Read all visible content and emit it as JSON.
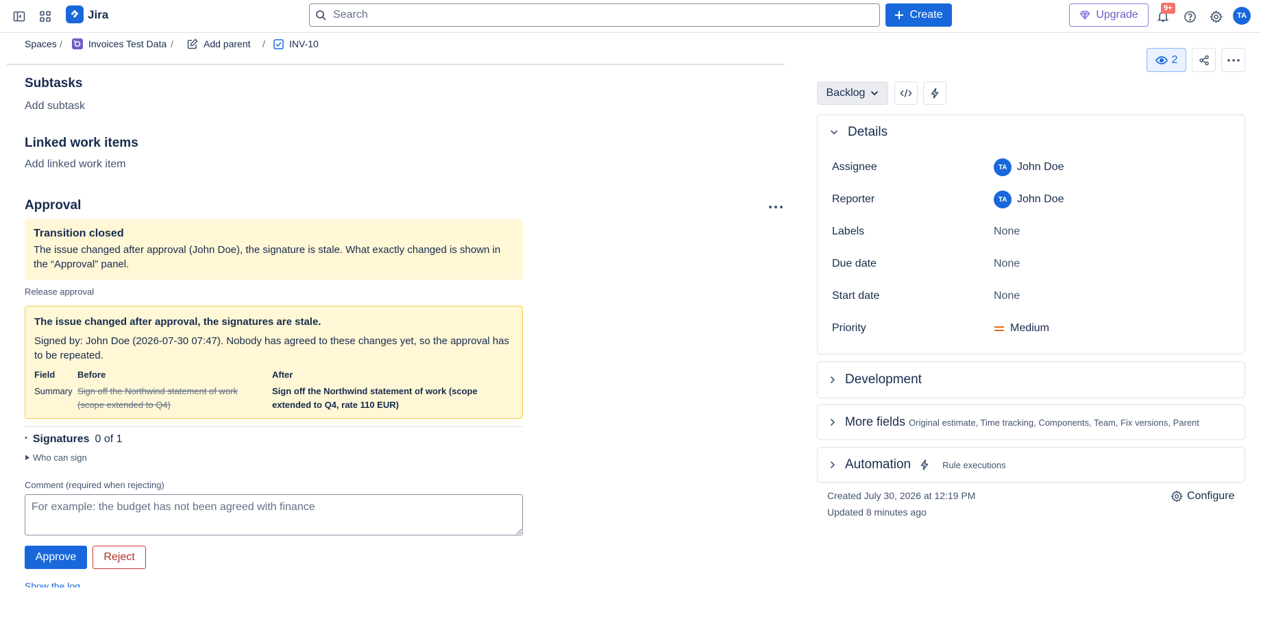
{
  "app": {
    "name": "Jira"
  },
  "search": {
    "placeholder": "Search"
  },
  "header": {
    "create_label": "Create",
    "upgrade_label": "Upgrade",
    "notifications_badge": "9+",
    "user_initials": "TA"
  },
  "breadcrumb": {
    "spaces": "Spaces",
    "project": "Invoices Test Data",
    "add_parent": "Add parent",
    "issue_key": "INV-10",
    "separator": "/"
  },
  "left": {
    "subtasks_title": "Subtasks",
    "add_subtask": "Add subtask",
    "linked_title": "Linked work items",
    "add_linked": "Add linked work item",
    "approval_title": "Approval",
    "banner": {
      "title": "Transition closed",
      "text": "The issue changed after approval (John Doe), the signature is stale. What exactly changed is shown in the “Approval” panel."
    },
    "release_label": "Release approval",
    "panel": {
      "title": "The issue changed after approval, the signatures are stale.",
      "text": "Signed by: John Doe (2026-07-30 07:47). Nobody has agreed to these changes yet, so the approval has to be repeated.",
      "col_field": "Field",
      "col_before": "Before",
      "col_after": "After",
      "row_field": "Summary",
      "row_before": "Sign off the Northwind statement of work (scope extended to Q4)",
      "row_after": "Sign off the Northwind statement of work (scope extended to Q4, rate 110 EUR)"
    },
    "signatures_label": "Signatures",
    "signatures_count": "0 of 1",
    "who_can_sign": "Who can sign",
    "comment_label": "Comment (required when rejecting)",
    "comment_placeholder": "For example: the budget has not been agreed with finance",
    "approve_label": "Approve",
    "reject_label": "Reject",
    "show_log": "Show the log"
  },
  "right": {
    "watchers_count": "2",
    "status_label": "Backlog",
    "details_title": "Details",
    "fields": {
      "assignee_label": "Assignee",
      "assignee_value": "John Doe",
      "assignee_initials": "TA",
      "reporter_label": "Reporter",
      "reporter_value": "John Doe",
      "reporter_initials": "TA",
      "labels_label": "Labels",
      "labels_value": "None",
      "due_label": "Due date",
      "due_value": "None",
      "start_label": "Start date",
      "start_value": "None",
      "priority_label": "Priority",
      "priority_value": "Medium"
    },
    "development_title": "Development",
    "more_fields_title": "More fields",
    "more_fields_hint": "Original estimate, Time tracking, Components, Team, Fix versions, Parent",
    "automation_title": "Automation",
    "automation_hint": "Rule executions",
    "created": "Created July 30, 2026 at 12:19 PM",
    "updated": "Updated 8 minutes ago",
    "configure_label": "Configure"
  },
  "colors": {
    "brand": "#1868db",
    "warning_bg": "#fff7d6",
    "warning_border": "#f5cd47",
    "danger": "#c9372c",
    "upgrade": "#6e5dc6",
    "priority_medium": "#e56910"
  },
  "icons": [
    "sidebar-toggle-icon",
    "app-switcher-icon",
    "jira-logo-icon",
    "search-icon",
    "plus-icon",
    "gem-icon",
    "bell-icon",
    "help-icon",
    "gear-icon",
    "project-icon",
    "edit-icon",
    "checkbox-icon",
    "eye-icon",
    "share-icon",
    "more-icon",
    "chevron-down-icon",
    "code-icon",
    "lightning-icon",
    "chevron-right-icon",
    "priority-medium-icon",
    "triangle-right-icon"
  ]
}
